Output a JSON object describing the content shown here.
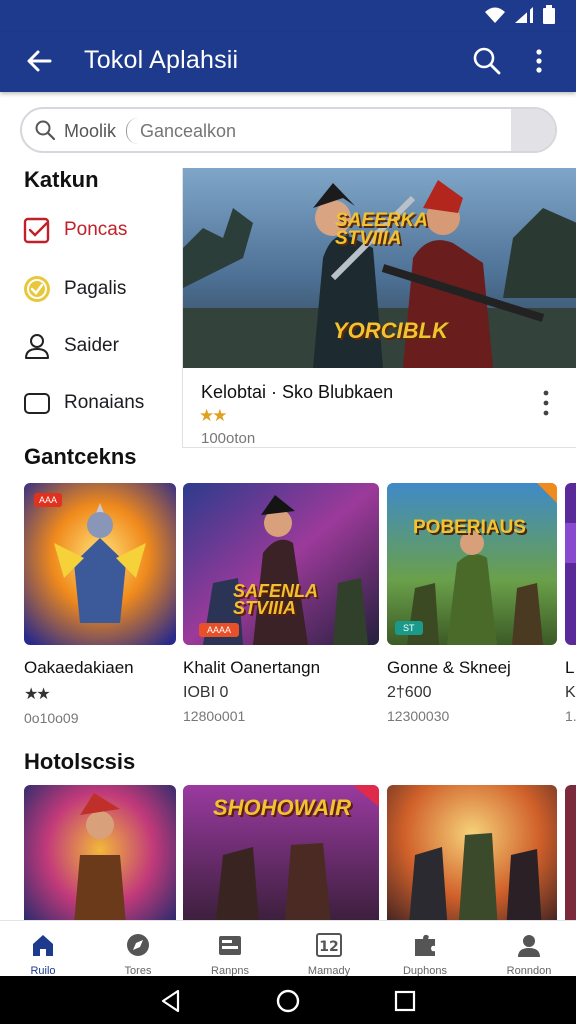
{
  "app": {
    "title": "Tokol Aplahsii"
  },
  "colors": {
    "primary": "#1d3a8c",
    "accent": "#c0202a",
    "star": "#e0a020"
  },
  "search": {
    "label": "Moolik",
    "placeholder": "Gancealkon"
  },
  "categories": {
    "title": "Katkun",
    "items": [
      {
        "label": "Poncas",
        "icon": "calendar-check-icon"
      },
      {
        "label": "Pagalis",
        "icon": "check-circle-icon"
      },
      {
        "label": "Saider",
        "icon": "person-icon"
      },
      {
        "label": "Ronaians",
        "icon": "rounded-square-icon"
      }
    ]
  },
  "featured": {
    "title": "Kelobtai · Sko Blubkaen",
    "rating": "★★",
    "meta": "100oton",
    "art_text_1": "SAEERKA STVIIIA",
    "art_text_2": "YORCIBLK"
  },
  "section1": {
    "title": "Gantcekns",
    "cards": [
      {
        "title": "Oakaedakiaen",
        "sub": "★★",
        "meta": "0o10o09",
        "badge": "AAA"
      },
      {
        "title": "Khalit Oanertangn",
        "sub": "IOBI  0",
        "meta": "1280o001",
        "badge": "AAAA",
        "art_text": "SAFENLA STVIIIA"
      },
      {
        "title": "Gonne & Skneej",
        "sub": "2†600",
        "meta": "12300030",
        "badge": "ST",
        "art_text": "POBERIAUS"
      },
      {
        "title": "L",
        "sub": "K",
        "meta": "1."
      }
    ]
  },
  "section2": {
    "title": "Hotolscsis",
    "cards": [
      {
        "art_text": ""
      },
      {
        "art_text": "SHOHOWAIR"
      },
      {
        "art_text": ""
      },
      {
        "art_text": ""
      }
    ]
  },
  "bottom_nav": [
    {
      "label": "Ruilo",
      "icon": "home-icon"
    },
    {
      "label": "Tores",
      "icon": "compass-icon"
    },
    {
      "label": "Ranpns",
      "icon": "card-icon"
    },
    {
      "label": "Mamady",
      "icon": "number-icon"
    },
    {
      "label": "Duphons",
      "icon": "puzzle-icon"
    },
    {
      "label": "Ronndon",
      "icon": "account-icon"
    }
  ]
}
